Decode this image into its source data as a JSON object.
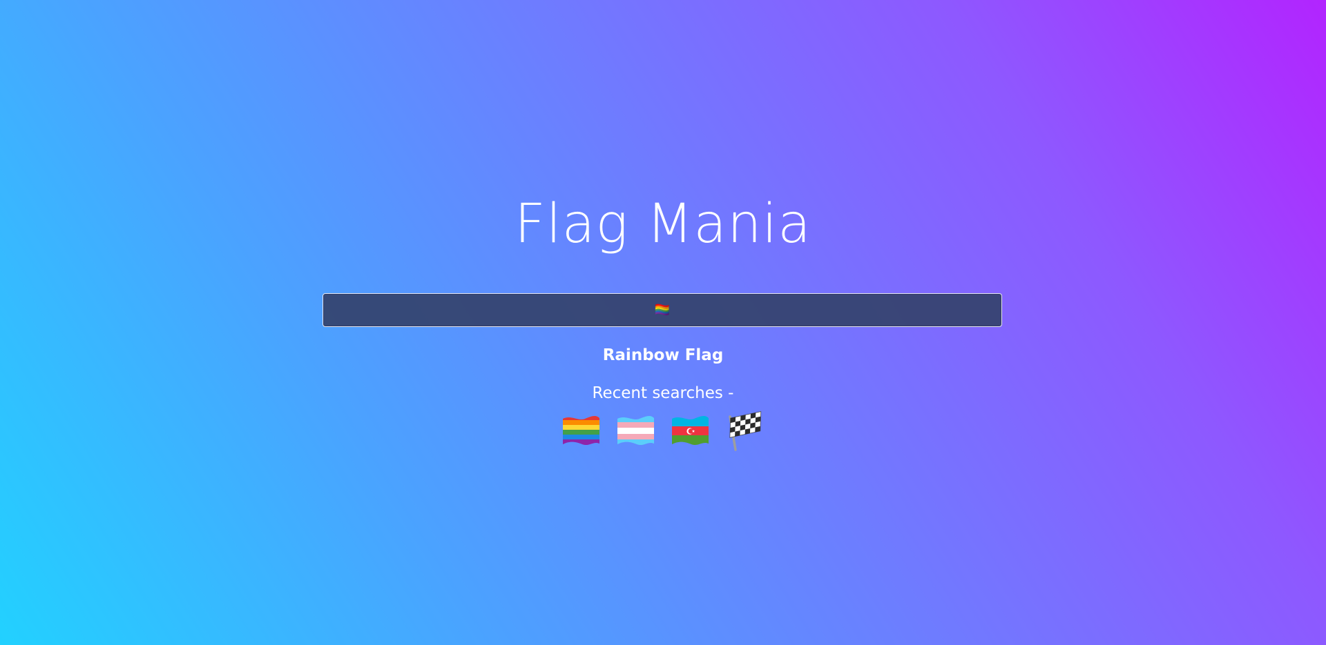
{
  "header": {
    "title": "Flag Mania"
  },
  "search": {
    "value": "🏳️‍🌈",
    "placeholder": ""
  },
  "result": {
    "name": "Rainbow Flag"
  },
  "recent": {
    "label": "Recent searches -",
    "items": [
      {
        "icon": "rainbow-flag-icon",
        "emoji": "🏳️‍🌈"
      },
      {
        "icon": "transgender-flag-icon",
        "emoji": "🏳️‍⚧️"
      },
      {
        "icon": "azerbaijan-flag-icon",
        "emoji": "🇦🇿"
      },
      {
        "icon": "chequered-flag-icon",
        "emoji": "🏁"
      }
    ]
  },
  "colors": {
    "gradient_start": "#22d1ff",
    "gradient_end": "#b224ff",
    "search_bg": "#34426c"
  }
}
